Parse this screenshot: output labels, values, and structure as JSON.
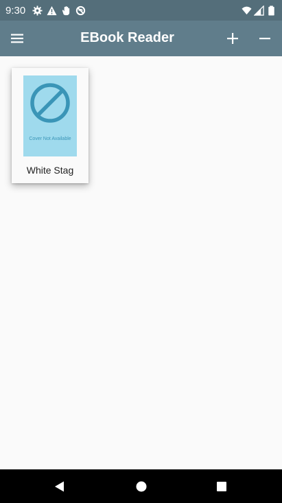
{
  "status_bar": {
    "time": "9:30",
    "left_icons": [
      "settings-icon",
      "warning-icon",
      "hand-icon",
      "no-signal-icon"
    ],
    "right_icons": [
      "wifi-icon",
      "cell-signal-icon",
      "battery-icon"
    ]
  },
  "app_bar": {
    "title": "EBook Reader",
    "background": "#607d8b",
    "status_background": "#546e7a"
  },
  "books": [
    {
      "title": "White Stag",
      "cover_text": "Cover Not Available",
      "cover_color": "#9fdaed",
      "cover_accent": "#3a95b7"
    }
  ],
  "nav_bar": {
    "buttons": [
      "back",
      "home",
      "recents"
    ]
  }
}
